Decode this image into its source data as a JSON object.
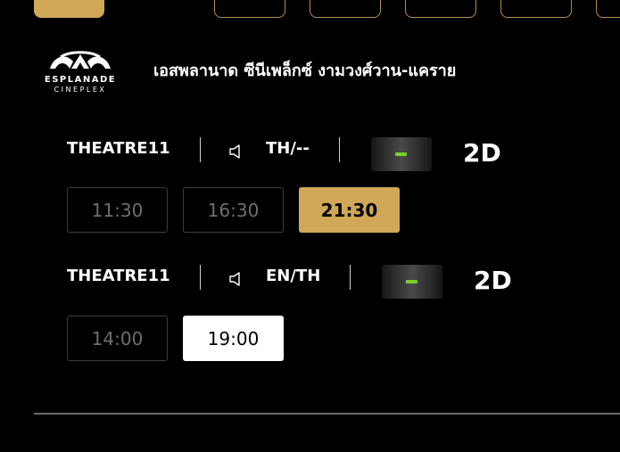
{
  "cinema": {
    "logo_main": "ESPLANADE",
    "logo_sub": "CINEPLEX",
    "name": "เอสพลานาด ซีนีเพล็กซ์ งามวงศ์วาน-แคราย"
  },
  "showtimes": [
    {
      "theatre": "THEATRE11",
      "language": "TH/--",
      "rating_icon": "rating-dash-icon",
      "format": "2D",
      "times": [
        {
          "time": "11:30",
          "state": "past"
        },
        {
          "time": "16:30",
          "state": "past"
        },
        {
          "time": "21:30",
          "state": "selected"
        }
      ]
    },
    {
      "theatre": "THEATRE11",
      "language": "EN/TH",
      "rating_icon": "rating-dash-icon",
      "format": "2D",
      "times": [
        {
          "time": "14:00",
          "state": "past"
        },
        {
          "time": "19:00",
          "state": "available"
        }
      ]
    }
  ],
  "colors": {
    "background": "#000000",
    "accent_gold": "#d0a857",
    "rating_green": "#7ccf2a",
    "past_text": "#6e6e6e"
  }
}
